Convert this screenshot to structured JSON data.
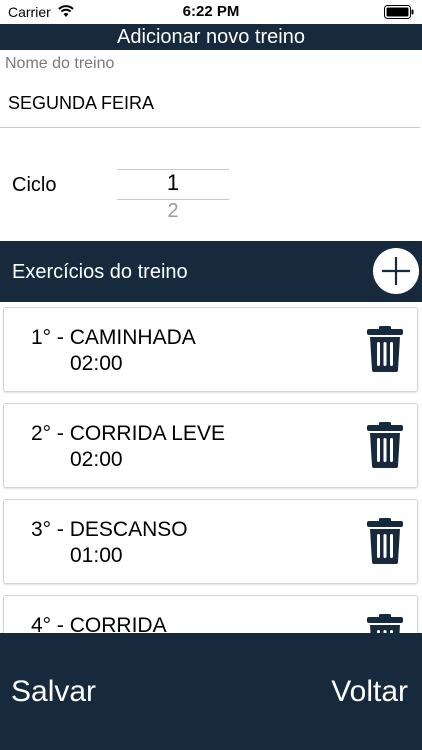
{
  "status_bar": {
    "carrier": "Carrier",
    "time": "6:22 PM"
  },
  "header": {
    "title": "Adicionar novo treino"
  },
  "form": {
    "name_label": "Nome do treino",
    "name_value": "SEGUNDA FEIRA",
    "cycle_label": "Ciclo",
    "cycle_selected": "1",
    "cycle_next": "2"
  },
  "exercises": {
    "title": "Exercícios do treino",
    "items": [
      {
        "name": "1° - CAMINHADA",
        "duration": "02:00"
      },
      {
        "name": "2° - CORRIDA LEVE",
        "duration": "02:00"
      },
      {
        "name": "3° - DESCANSO",
        "duration": "01:00"
      },
      {
        "name": "4° - CORRIDA",
        "duration": ""
      }
    ]
  },
  "footer": {
    "save_label": "Salvar",
    "back_label": "Voltar"
  },
  "colors": {
    "primary": "#172a3d",
    "background": "#ffffff"
  },
  "icons": {
    "add": "plus-circle-icon",
    "delete": "trash-icon",
    "wifi": "wifi-icon",
    "battery": "battery-icon"
  }
}
